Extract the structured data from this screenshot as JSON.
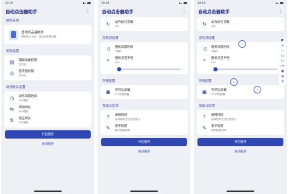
{
  "status_bar": {
    "time": "10:19"
  },
  "app": {
    "title": "自动点击器助手",
    "menu_glyph": "⋮"
  },
  "sections": {
    "support": "拥有支持",
    "permissions": "权限设置",
    "defaults": "动作默认设置",
    "anti_detect": "反检测设置",
    "storage": "存储配置",
    "help": "帮助与反馈"
  },
  "support_card": {
    "title": "自动点击器助手",
    "subtitle": "模拟真人点击、自动点击等功能"
  },
  "permission_items": [
    {
      "icon": "accessibility-icon",
      "glyph": "▤",
      "title": "辅助功能权限",
      "sub": "已开启"
    },
    {
      "icon": "overlay-icon",
      "glyph": "◎",
      "title": "悬浮窗权限",
      "sub": "已开启"
    }
  ],
  "default_items": [
    {
      "icon": "clock-icon",
      "glyph": "◷",
      "title": "动作间隔时间",
      "sub": "500毫秒"
    },
    {
      "icon": "swipe-icon",
      "glyph": "⇆",
      "title": "滑动时长",
      "sub": "300毫秒"
    },
    {
      "icon": "hold-icon",
      "glyph": "⇅",
      "title": "按压时长",
      "sub": "300毫秒"
    }
  ],
  "repeat_item": {
    "icon": "repeat-icon",
    "glyph": "↻",
    "title": "动作执行次数",
    "sub": "0次"
  },
  "anti_items": [
    {
      "icon": "shuffle-icon",
      "glyph": "⤨",
      "title": "随机间隔时间",
      "sub": "0毫秒"
    },
    {
      "icon": "location-icon",
      "glyph": "⌖",
      "title": "随机点击半径",
      "sub": "0px"
    }
  ],
  "slider": {
    "value": 0
  },
  "storage_item": {
    "icon": "save-icon",
    "glyph": "▣",
    "title": "存档与加载",
    "sub": "0个存档配置"
  },
  "help_items": [
    {
      "icon": "faq-icon",
      "glyph": "?",
      "title": "故障排除",
      "sub": "启动程序无法正常运行"
    },
    {
      "icon": "guide-icon",
      "glyph": "✎",
      "title": "新手指南",
      "sub": "操作指南说明"
    }
  ],
  "buttons": {
    "start": "开启服务",
    "close": "关闭服务"
  },
  "float_toolbar": [
    "▶",
    "+",
    "−",
    "▭",
    "▭",
    "▭",
    "◉",
    "⚙",
    "✕"
  ],
  "targets": [
    "①",
    "②",
    "③"
  ]
}
